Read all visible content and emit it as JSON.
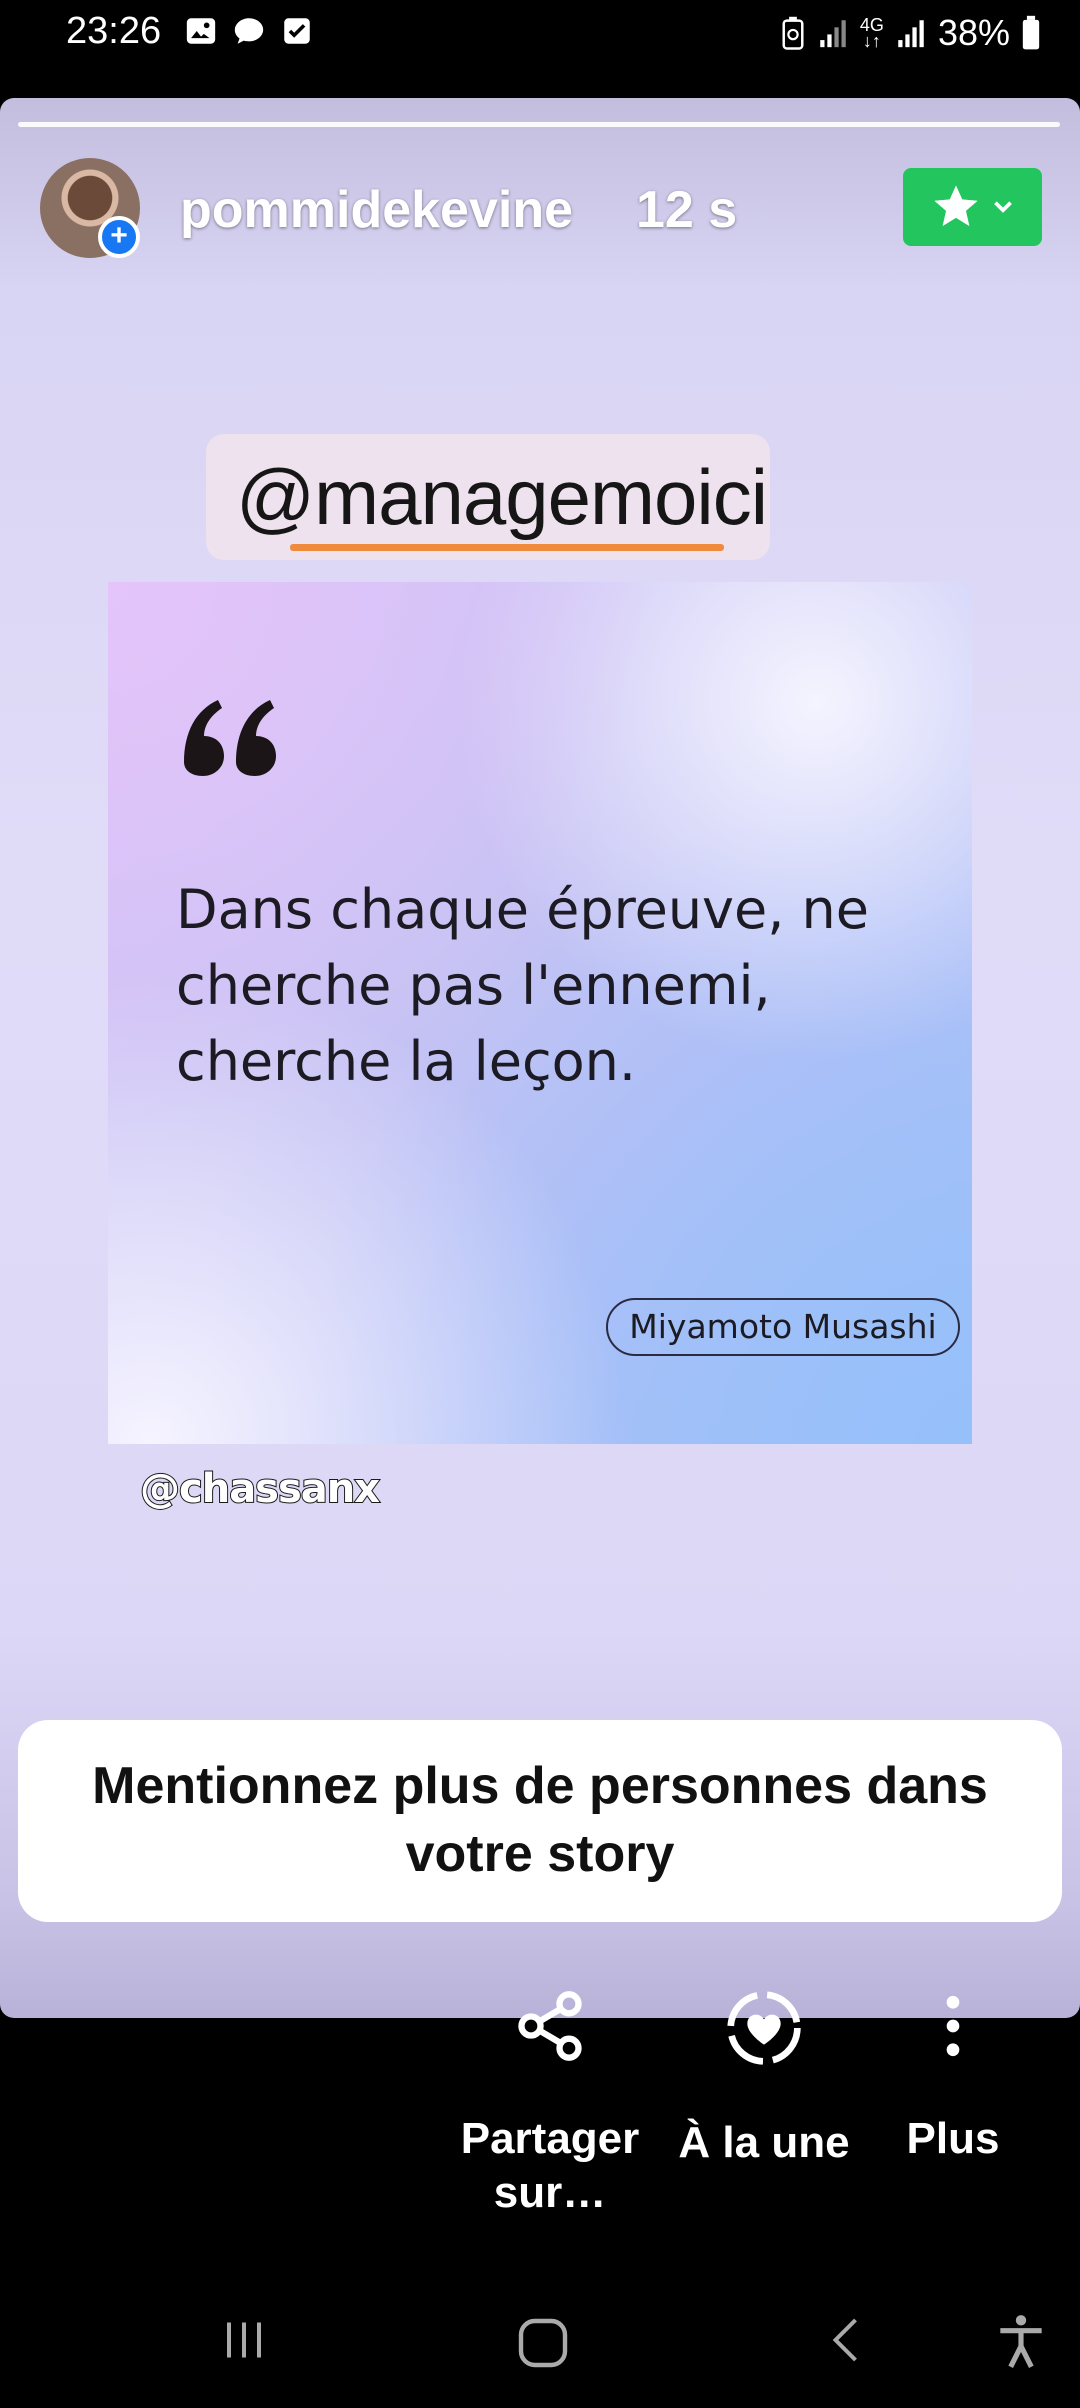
{
  "status_bar": {
    "time": "23:26",
    "left_icons": [
      "gallery-icon",
      "chat-bubble-icon",
      "checkbox-icon"
    ],
    "network": "4G",
    "battery": "38%"
  },
  "story": {
    "username": "pommidekevine",
    "time_ago": "12 s",
    "close_friends_color": "#22c55e",
    "mention_sticker": "@managemoici",
    "quote": {
      "text": "Dans chaque épreuve, ne cherche pas l'ennemi, cherche la leçon.",
      "author": "Miyamoto Musashi"
    },
    "bottom_mention": "@chassanx"
  },
  "tooltip": {
    "text": "Mentionnez plus de personnes dans votre story"
  },
  "actions": {
    "share_label": "Partager sur…",
    "feature_label": "À la une",
    "more_label": "Plus"
  },
  "nav": {
    "recents": "recents-icon",
    "home": "home-icon",
    "back": "back-icon",
    "accessibility": "accessibility-icon"
  }
}
